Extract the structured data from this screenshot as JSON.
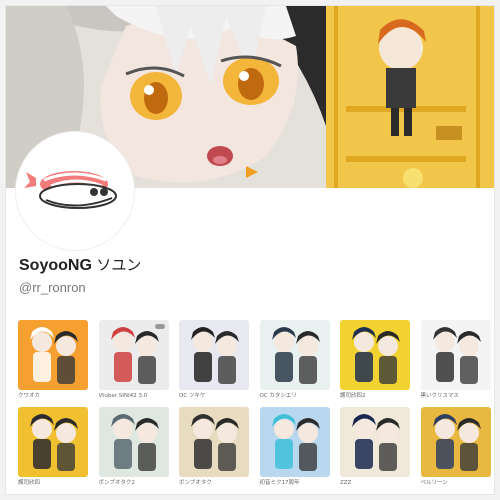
{
  "profile": {
    "display_name": "SoyooNG",
    "display_name_jp": "ソユン",
    "handle": "@rr_ronron"
  },
  "colors": {
    "banner_bg": "#d8cfc2",
    "eye": "#f0a020",
    "accent_yellow": "#f2c32a",
    "avatar_fish": "#f08c8c"
  },
  "gallery": [
    {
      "caption": "クワオカ",
      "bg": "#f5a030",
      "accent": "#ffffff"
    },
    {
      "caption": "Vtuber SINI42 3.0",
      "bg": "#ececec",
      "accent": "#d04040"
    },
    {
      "caption": "OC ツキケ",
      "bg": "#e8e8f0",
      "accent": "#222222"
    },
    {
      "caption": "OC カタシエリ",
      "bg": "#e8f0f0",
      "accent": "#2a3a4a"
    },
    {
      "caption": "護司欣四2",
      "bg": "#f2d230",
      "accent": "#203050"
    },
    {
      "caption": "黒いクリスマス",
      "bg": "#f4f4f4",
      "accent": "#333333"
    },
    {
      "caption": "護司欣四",
      "bg": "#f0c030",
      "accent": "#2a2a30"
    },
    {
      "caption": "ボンブオタク2",
      "bg": "#dfe8e0",
      "accent": "#5a6a70"
    },
    {
      "caption": "ボンブオタク",
      "bg": "#e8dcc0",
      "accent": "#303030"
    },
    {
      "caption": "初音ミク17周年",
      "bg": "#b8d8f0",
      "accent": "#40c0d8"
    },
    {
      "caption": "ZZZ",
      "bg": "#f0e8d8",
      "accent": "#1a2850"
    },
    {
      "caption": "ベルリーン",
      "bg": "#e8b840",
      "accent": "#304060"
    }
  ]
}
